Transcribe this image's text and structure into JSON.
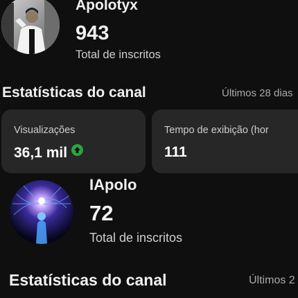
{
  "channels": [
    {
      "name": "Apolotyx",
      "subscribers": "943",
      "subscribers_label": "Total de inscritos",
      "section_title": "Estatísticas do canal",
      "period": "Últimos 28 dias",
      "cards": [
        {
          "label": "Visualizações",
          "value": "36,1 mil",
          "icon": "trend-up-icon"
        },
        {
          "label": "Tempo de exibição (hor",
          "value": "111"
        }
      ]
    },
    {
      "name": "IApolo",
      "subscribers": "72",
      "subscribers_label": "Total de inscritos",
      "section_title": "Estatísticas do canal",
      "period": "Últimos 2"
    }
  ],
  "colors": {
    "background": "#0f0f0f",
    "card": "#272727",
    "trend_up": "#2ba640",
    "secondary_text": "#aaaaaa"
  }
}
